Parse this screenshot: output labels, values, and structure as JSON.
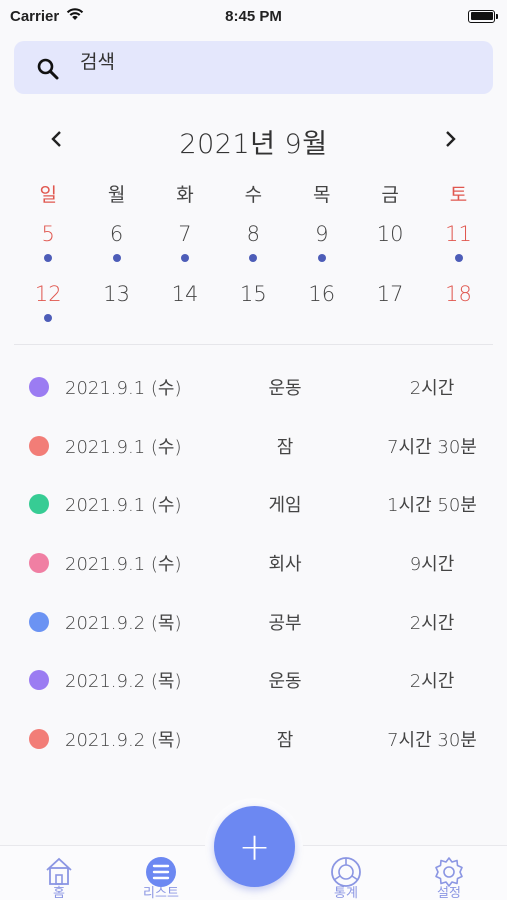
{
  "status_bar": {
    "carrier": "Carrier",
    "time": "8:45 PM"
  },
  "search": {
    "placeholder": "검색"
  },
  "calendar": {
    "title": "2021년 9월",
    "weekdays": [
      "일",
      "월",
      "화",
      "수",
      "목",
      "금",
      "토"
    ],
    "weeks": [
      [
        {
          "day": "5",
          "has_event": true
        },
        {
          "day": "6",
          "has_event": true
        },
        {
          "day": "7",
          "has_event": true
        },
        {
          "day": "8",
          "has_event": true
        },
        {
          "day": "9",
          "has_event": true
        },
        {
          "day": "10",
          "has_event": false
        },
        {
          "day": "11",
          "has_event": true
        }
      ],
      [
        {
          "day": "12",
          "has_event": true
        },
        {
          "day": "13",
          "has_event": false
        },
        {
          "day": "14",
          "has_event": false
        },
        {
          "day": "15",
          "has_event": false
        },
        {
          "day": "16",
          "has_event": false
        },
        {
          "day": "17",
          "has_event": false
        },
        {
          "day": "18",
          "has_event": false
        }
      ]
    ]
  },
  "records": [
    {
      "color": "#9b7cf2",
      "date": "2021.9.1 (수)",
      "category": "운동",
      "duration": "2시간"
    },
    {
      "color": "#f27d77",
      "date": "2021.9.1 (수)",
      "category": "잠",
      "duration": "7시간 30분"
    },
    {
      "color": "#37cc94",
      "date": "2021.9.1 (수)",
      "category": "게임",
      "duration": "1시간 50분"
    },
    {
      "color": "#f07fa3",
      "date": "2021.9.1 (수)",
      "category": "회사",
      "duration": "9시간"
    },
    {
      "color": "#6b93f3",
      "date": "2021.9.2 (목)",
      "category": "공부",
      "duration": "2시간"
    },
    {
      "color": "#9b7cf2",
      "date": "2021.9.2 (목)",
      "category": "운동",
      "duration": "2시간"
    },
    {
      "color": "#f27d77",
      "date": "2021.9.2 (목)",
      "category": "잠",
      "duration": "7시간 30분"
    }
  ],
  "tabbar": {
    "home": "홈",
    "list": "리스트",
    "stats": "통계",
    "settings": "설정",
    "add_label": "+"
  },
  "colors": {
    "accent": "#6c88f2",
    "weekend_red": "#e0574f",
    "event_dot": "#4d5db8",
    "search_bg": "#e4e7fc"
  }
}
